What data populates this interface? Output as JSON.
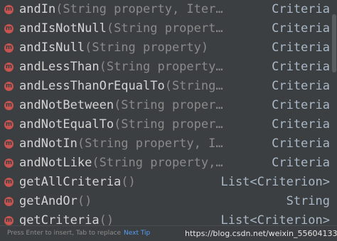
{
  "completion": {
    "items": [
      {
        "badge": "m",
        "name": "andIn",
        "params": "(String property, Iter…",
        "type": "Criteria"
      },
      {
        "badge": "m",
        "name": "andIsNotNull",
        "params": "(String propert…",
        "type": "Criteria"
      },
      {
        "badge": "m",
        "name": "andIsNull",
        "params": "(String property)",
        "type": "Criteria"
      },
      {
        "badge": "m",
        "name": "andLessThan",
        "params": "(String property…",
        "type": "Criteria"
      },
      {
        "badge": "m",
        "name": "andLessThanOrEqualTo",
        "params": "(String…",
        "type": "Criteria"
      },
      {
        "badge": "m",
        "name": "andNotBetween",
        "params": "(String proper…",
        "type": "Criteria"
      },
      {
        "badge": "m",
        "name": "andNotEqualTo",
        "params": "(String proper…",
        "type": "Criteria"
      },
      {
        "badge": "m",
        "name": "andNotIn",
        "params": "(String property, I…",
        "type": "Criteria"
      },
      {
        "badge": "m",
        "name": "andNotLike",
        "params": "(String property,…",
        "type": "Criteria"
      },
      {
        "badge": "m",
        "name": "getAllCriteria",
        "params": "()",
        "type": "List<Criterion>"
      },
      {
        "badge": "m",
        "name": "getAndOr",
        "params": "()",
        "type": "String"
      },
      {
        "badge": "m",
        "name": "getCriteria",
        "params": "()",
        "type": "List<Criterion>"
      }
    ]
  },
  "statusbar": {
    "hint": "Press Enter to insert, Tab to replace",
    "next_tip": "Next Tip"
  },
  "watermark": "https://blog.csdn.net/weixin_55604133",
  "colors": {
    "background": "#3c3f41",
    "method_badge": "#c75450",
    "link": "#589df6"
  }
}
